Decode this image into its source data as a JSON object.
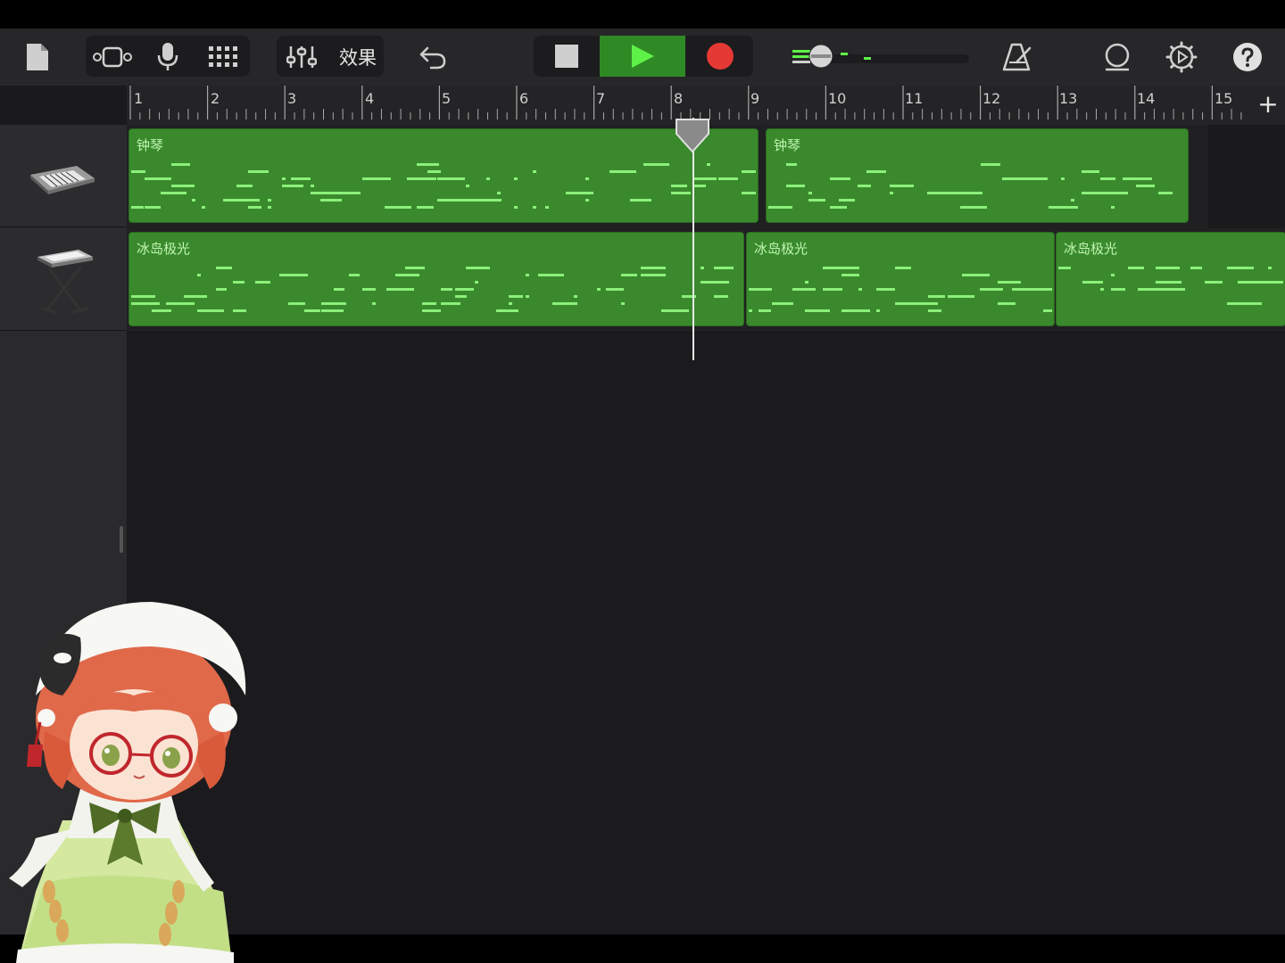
{
  "toolbar": {
    "effects_label": "效果",
    "colors": {
      "play": "#2f8a25",
      "record": "#e53935"
    }
  },
  "ruler": {
    "bars": [
      "1",
      "2",
      "3",
      "4",
      "5",
      "6",
      "7",
      "8",
      "9",
      "10",
      "11",
      "12",
      "13",
      "14",
      "15"
    ],
    "add_label": "+"
  },
  "tracks": [
    {
      "instrument": "synth-keyboard-icon",
      "regions": [
        {
          "label": "钟琴"
        },
        {
          "label": "钟琴"
        }
      ]
    },
    {
      "instrument": "keyboard-stand-icon",
      "regions": [
        {
          "label": "冰岛极光"
        },
        {
          "label": "冰岛极光"
        },
        {
          "label": "冰岛极光"
        }
      ]
    }
  ],
  "colors": {
    "region": "#3a8a2d",
    "notes": "#8bf07a",
    "label": "#bff5b0"
  }
}
